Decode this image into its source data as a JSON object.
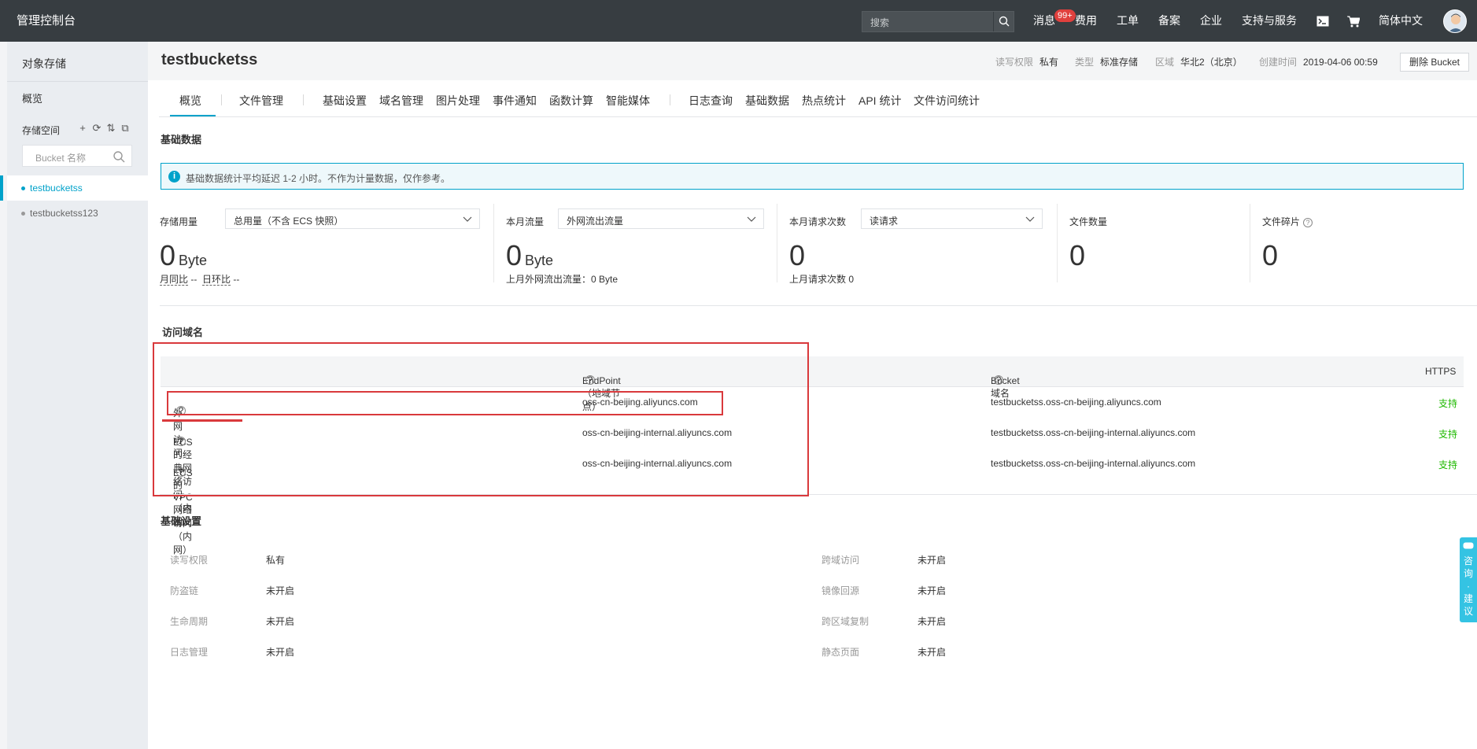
{
  "topbar": {
    "brand": "管理控制台",
    "search_placeholder": "搜索",
    "nav": [
      "消息",
      "费用",
      "工单",
      "备案",
      "企业",
      "支持与服务",
      "简体中文"
    ],
    "badge": "99+"
  },
  "sidebar": {
    "title": "对象存储",
    "overview": "概览",
    "space_label": "存储空间",
    "tools": [
      "+",
      "⟳",
      "⇅",
      "⧉"
    ],
    "search_placeholder": "Bucket 名称",
    "buckets": [
      {
        "name": "testbucketss",
        "active": true
      },
      {
        "name": "testbucketss123",
        "active": false
      }
    ]
  },
  "header": {
    "bucket_name": "testbucketss",
    "acl_label": "读写权限",
    "acl_value": "私有",
    "type_label": "类型",
    "type_value": "标准存储",
    "region_label": "区域",
    "region_value": "华北2（北京）",
    "created_label": "创建时间",
    "created_value": "2019-04-06 00:59",
    "delete_button": "删除 Bucket"
  },
  "tabs": [
    "概览",
    "文件管理",
    "基础设置",
    "域名管理",
    "图片处理",
    "事件通知",
    "函数计算",
    "智能媒体",
    "日志查询",
    "基础数据",
    "热点统计",
    "API 统计",
    "文件访问统计"
  ],
  "basic_data": {
    "title": "基础数据",
    "notice": "基础数据统计平均延迟 1-2 小时。不作为计量数据，仅作参考。",
    "storage": {
      "label": "存储用量",
      "select": "总用量（不含 ECS 快照）",
      "value": "0",
      "unit": "Byte",
      "sub1": "月同比",
      "sub1_val": "--",
      "sub2": "日环比",
      "sub2_val": "--"
    },
    "traffic": {
      "label": "本月流量",
      "select": "外网流出流量",
      "value": "0",
      "unit": "Byte",
      "sub": "上月外网流出流量：0 Byte"
    },
    "requests": {
      "label": "本月请求次数",
      "select": "读请求",
      "value": "0",
      "sub": "上月请求次数  0"
    },
    "files": {
      "label": "文件数量",
      "value": "0"
    },
    "fragments": {
      "label": "文件碎片",
      "value": "0"
    }
  },
  "domains": {
    "title": "访问域名",
    "headers": {
      "endpoint": "EndPoint（地域节点）",
      "bucket_domain": "Bucket 域名",
      "https": "HTTPS"
    },
    "rows": [
      {
        "type": "外网访问",
        "endpoint": "oss-cn-beijing.aliyuncs.com",
        "domain": "testbucketss.oss-cn-beijing.aliyuncs.com",
        "https": "支持"
      },
      {
        "type": "ECS 的经典网络访问（内网）",
        "endpoint": "oss-cn-beijing-internal.aliyuncs.com",
        "domain": "testbucketss.oss-cn-beijing-internal.aliyuncs.com",
        "https": "支持"
      },
      {
        "type": "ECS 的 VPC 网络访问（内网）",
        "endpoint": "oss-cn-beijing-internal.aliyuncs.com",
        "domain": "testbucketss.oss-cn-beijing-internal.aliyuncs.com",
        "https": "支持"
      }
    ]
  },
  "settings": {
    "title": "基础设置",
    "left": [
      {
        "k": "读写权限",
        "v": "私有"
      },
      {
        "k": "防盗链",
        "v": "未开启"
      },
      {
        "k": "生命周期",
        "v": "未开启"
      },
      {
        "k": "日志管理",
        "v": "未开启"
      }
    ],
    "right": [
      {
        "k": "跨域访问",
        "v": "未开启"
      },
      {
        "k": "镜像回源",
        "v": "未开启"
      },
      {
        "k": "跨区域复制",
        "v": "未开启"
      },
      {
        "k": "静态页面",
        "v": "未开启"
      }
    ]
  },
  "float_tab": "咨询·建议",
  "colors": {
    "accent": "#00a2ca",
    "topbar": "#373d41",
    "annotation_red": "#d9393c",
    "success": "#1eb900"
  }
}
